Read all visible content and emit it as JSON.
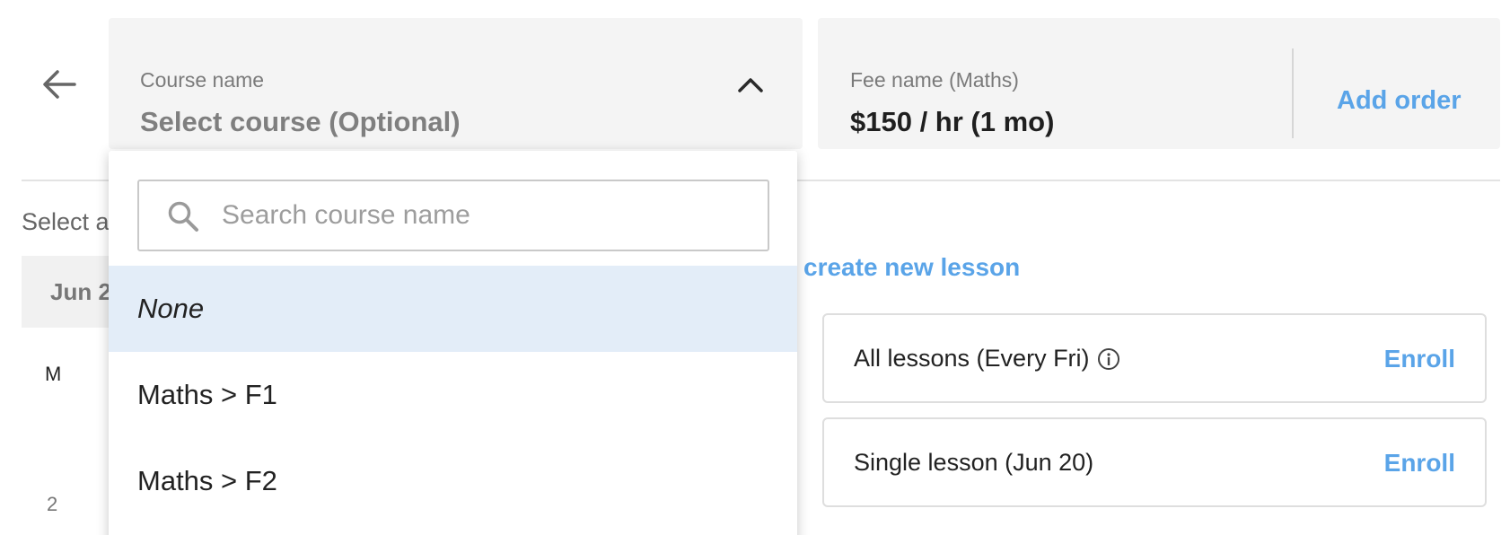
{
  "header": {
    "back_icon": "arrow-left-icon"
  },
  "course_select": {
    "label": "Course name",
    "value": "Select course (Optional)",
    "chevron_icon": "chevron-up-icon"
  },
  "fee": {
    "label": "Fee name (Maths)",
    "value": "$150 / hr (1 mo)",
    "add_order_label": "Add order"
  },
  "schedule": {
    "select_text": "Select a",
    "date_header": "Jun 2",
    "day_letter": "M",
    "day_number": "2",
    "create_lesson_label": "create new lesson"
  },
  "lessons": [
    {
      "label": "All lessons (Every Fri)",
      "enroll": "Enroll",
      "info_icon": "info-icon"
    },
    {
      "label": "Single lesson (Jun 20)",
      "enroll": "Enroll"
    }
  ],
  "dropdown": {
    "search_placeholder": "Search course name",
    "search_value": "",
    "search_icon": "search-icon",
    "options": [
      {
        "label": "None",
        "selected": true
      },
      {
        "label": "Maths > F1",
        "selected": false
      },
      {
        "label": "Maths > F2",
        "selected": false
      }
    ]
  },
  "colors": {
    "accent": "#5aa4e8",
    "field_bg": "#f4f4f4",
    "selected_bg": "#e3edf8"
  }
}
